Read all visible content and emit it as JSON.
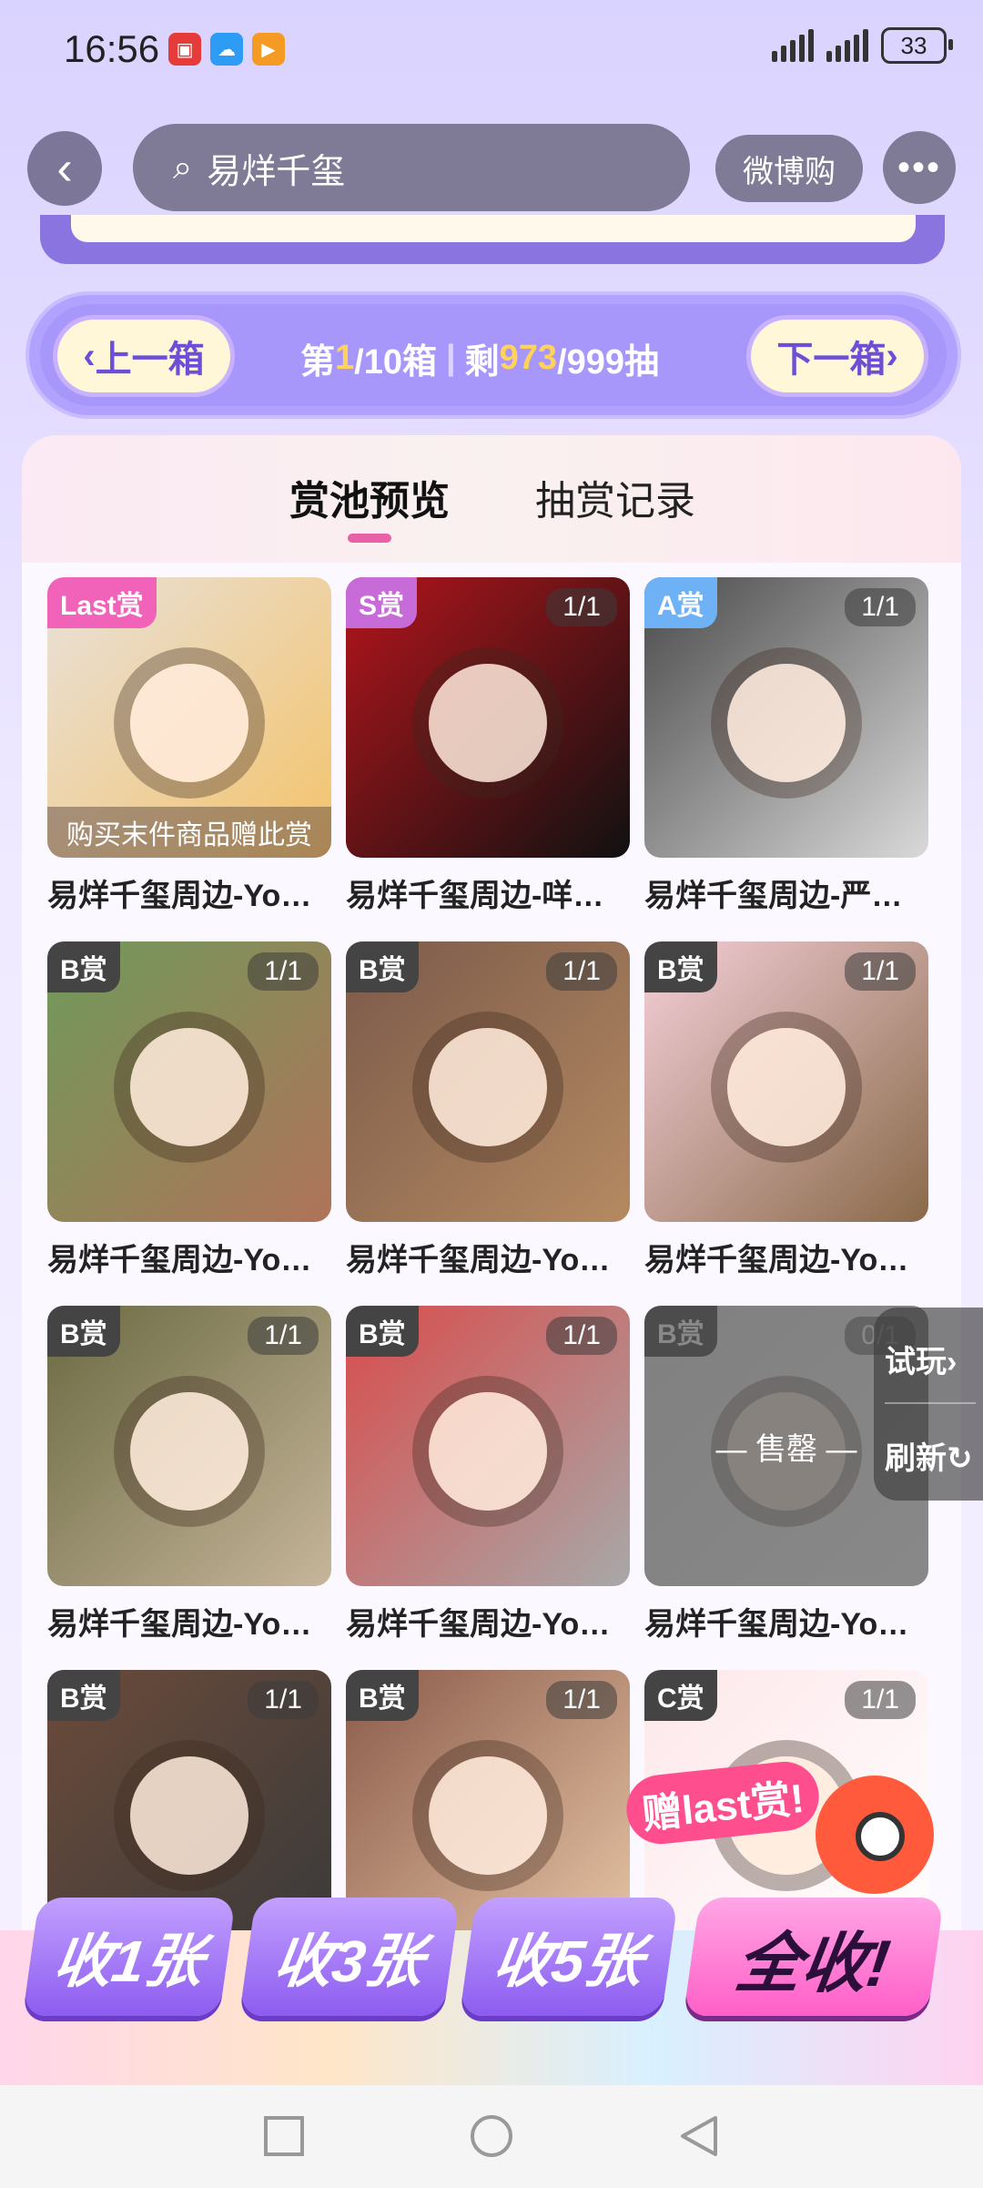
{
  "status_bar": {
    "time": "16:56",
    "battery": "33"
  },
  "header": {
    "search_value": "易烊千玺",
    "weibo_label": "微博购"
  },
  "box_nav": {
    "prev_label": "上一箱",
    "next_label": "下一箱",
    "prefix": "第",
    "current_box": "1",
    "total_boxes": "/10箱",
    "remain_prefix": "剩",
    "remaining": "973",
    "total_draws": "/999抽"
  },
  "tabs": [
    {
      "label": "赏池预览"
    },
    {
      "label": "抽赏记录"
    }
  ],
  "grid": [
    {
      "tag": "Last赏",
      "tag_color": "#f063b9",
      "count": "",
      "caption": "购买末件商品赠此赏",
      "title": "易烊千玺周边-Yo…",
      "sold": ""
    },
    {
      "tag": "S赏",
      "tag_color": "#c76bd8",
      "count": "1/1",
      "caption": "",
      "title": "易烊千玺周边-咩…",
      "sold": ""
    },
    {
      "tag": "A赏",
      "tag_color": "#6fb1f5",
      "count": "1/1",
      "caption": "",
      "title": "易烊千玺周边-严…",
      "sold": ""
    },
    {
      "tag": "B赏",
      "tag_color": "#444444",
      "count": "1/1",
      "caption": "",
      "title": "易烊千玺周边-Yo…",
      "sold": ""
    },
    {
      "tag": "B赏",
      "tag_color": "#444444",
      "count": "1/1",
      "caption": "",
      "title": "易烊千玺周边-Yo…",
      "sold": ""
    },
    {
      "tag": "B赏",
      "tag_color": "#444444",
      "count": "1/1",
      "caption": "",
      "title": "易烊千玺周边-Yo…",
      "sold": ""
    },
    {
      "tag": "B赏",
      "tag_color": "#444444",
      "count": "1/1",
      "caption": "",
      "title": "易烊千玺周边-Yo…",
      "sold": ""
    },
    {
      "tag": "B赏",
      "tag_color": "#444444",
      "count": "1/1",
      "caption": "",
      "title": "易烊千玺周边-Yo…",
      "sold": ""
    },
    {
      "tag": "B赏",
      "tag_color": "#444444",
      "count": "0/1",
      "caption": "",
      "title": "易烊千玺周边-Yo…",
      "sold": "售罄"
    },
    {
      "tag": "B赏",
      "tag_color": "#444444",
      "count": "1/1",
      "caption": "",
      "title": "",
      "sold": ""
    },
    {
      "tag": "B赏",
      "tag_color": "#444444",
      "count": "1/1",
      "caption": "",
      "title": "",
      "sold": ""
    },
    {
      "tag": "C赏",
      "tag_color": "#444444",
      "count": "1/1",
      "caption": "",
      "title": "",
      "sold": ""
    }
  ],
  "side": {
    "try_label": "试玩",
    "refresh_label": "刷新"
  },
  "bonus_badge": "赠last赏!",
  "actions": [
    {
      "label": "收1张"
    },
    {
      "label": "收3张"
    },
    {
      "label": "收5张"
    },
    {
      "label": "全收!"
    }
  ]
}
